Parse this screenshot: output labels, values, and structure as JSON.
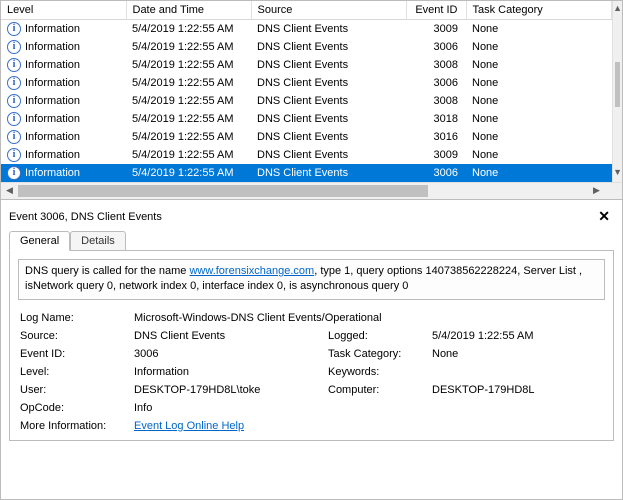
{
  "grid": {
    "columns": {
      "level": "Level",
      "datetime": "Date and Time",
      "source": "Source",
      "eventid": "Event ID",
      "taskcat": "Task Category"
    },
    "rows": [
      {
        "level": "Information",
        "datetime": "5/4/2019 1:22:55 AM",
        "source": "DNS Client Events",
        "eventid": "3009",
        "taskcat": "None"
      },
      {
        "level": "Information",
        "datetime": "5/4/2019 1:22:55 AM",
        "source": "DNS Client Events",
        "eventid": "3006",
        "taskcat": "None"
      },
      {
        "level": "Information",
        "datetime": "5/4/2019 1:22:55 AM",
        "source": "DNS Client Events",
        "eventid": "3008",
        "taskcat": "None"
      },
      {
        "level": "Information",
        "datetime": "5/4/2019 1:22:55 AM",
        "source": "DNS Client Events",
        "eventid": "3006",
        "taskcat": "None"
      },
      {
        "level": "Information",
        "datetime": "5/4/2019 1:22:55 AM",
        "source": "DNS Client Events",
        "eventid": "3008",
        "taskcat": "None"
      },
      {
        "level": "Information",
        "datetime": "5/4/2019 1:22:55 AM",
        "source": "DNS Client Events",
        "eventid": "3018",
        "taskcat": "None"
      },
      {
        "level": "Information",
        "datetime": "5/4/2019 1:22:55 AM",
        "source": "DNS Client Events",
        "eventid": "3016",
        "taskcat": "None"
      },
      {
        "level": "Information",
        "datetime": "5/4/2019 1:22:55 AM",
        "source": "DNS Client Events",
        "eventid": "3009",
        "taskcat": "None"
      },
      {
        "level": "Information",
        "datetime": "5/4/2019 1:22:55 AM",
        "source": "DNS Client Events",
        "eventid": "3006",
        "taskcat": "None"
      }
    ],
    "selected_index": 8
  },
  "details": {
    "title": "Event 3006, DNS Client Events",
    "close": "✕",
    "tabs": {
      "general": "General",
      "details": "Details"
    },
    "description_pre": "DNS query is called for the name ",
    "description_link": "www.forensixchange.com",
    "description_post": ", type 1, query options 140738562228224, Server List , isNetwork query 0, network index 0, interface index 0, is asynchronous query 0",
    "labels": {
      "logname": "Log Name:",
      "source": "Source:",
      "logged": "Logged:",
      "eventid": "Event ID:",
      "taskcat": "Task Category:",
      "level": "Level:",
      "keywords": "Keywords:",
      "user": "User:",
      "computer": "Computer:",
      "opcode": "OpCode:",
      "moreinfo": "More Information:"
    },
    "values": {
      "logname": "Microsoft-Windows-DNS Client Events/Operational",
      "source": "DNS Client Events",
      "logged": "5/4/2019 1:22:55 AM",
      "eventid": "3006",
      "taskcat": "None",
      "level": "Information",
      "keywords": "",
      "user": "DESKTOP-179HD8L\\toke",
      "computer": "DESKTOP-179HD8L",
      "opcode": "Info",
      "moreinfo_link": "Event Log Online Help"
    }
  }
}
